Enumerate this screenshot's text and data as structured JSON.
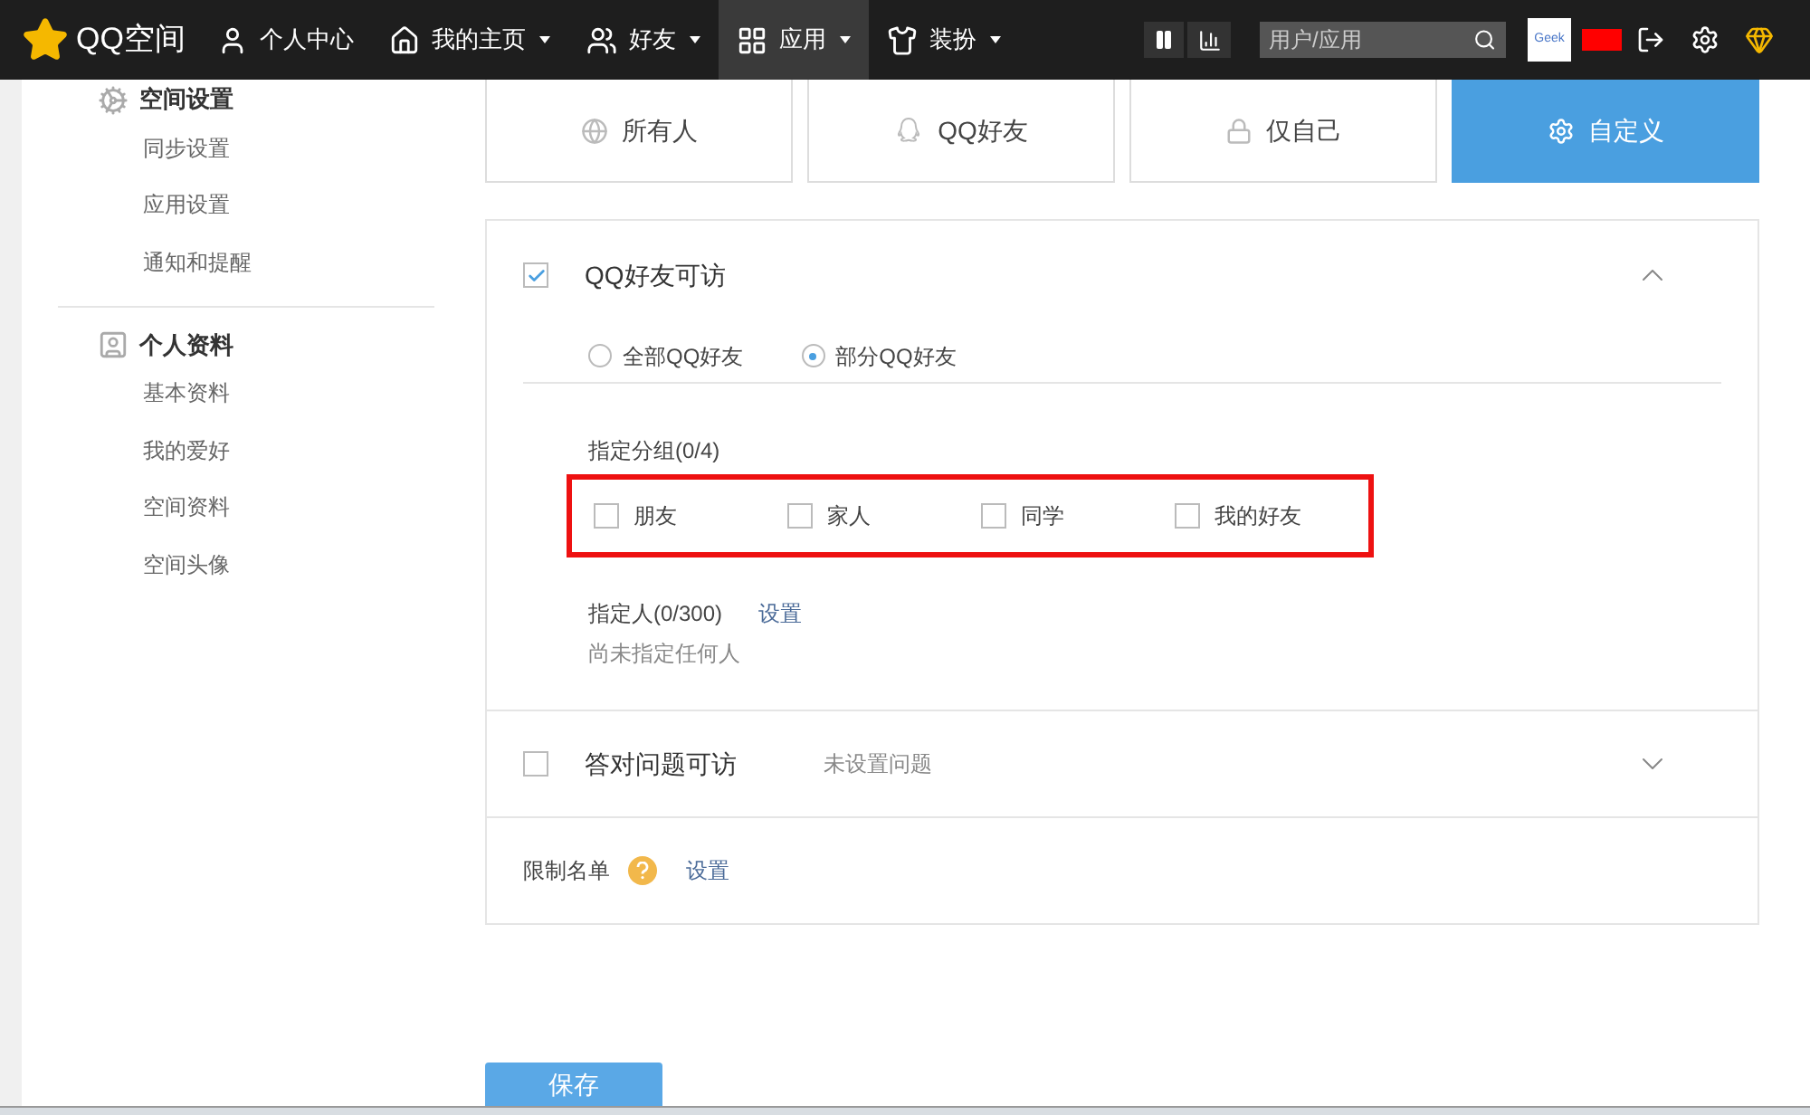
{
  "navbar": {
    "logo": "QQ空间",
    "items": [
      {
        "label": "个人中心",
        "dropdown": false,
        "selected": false
      },
      {
        "label": "我的主页",
        "dropdown": true,
        "selected": false
      },
      {
        "label": "好友",
        "dropdown": true,
        "selected": false
      },
      {
        "label": "应用",
        "dropdown": true,
        "selected": true
      },
      {
        "label": "装扮",
        "dropdown": true,
        "selected": false
      }
    ],
    "search": {
      "placeholder": "用户/应用"
    },
    "avatar_text": "Geek"
  },
  "sidebar": {
    "groups": [
      {
        "title": "空间设置",
        "items": [
          "同步设置",
          "应用设置",
          "通知和提醒"
        ]
      },
      {
        "title": "个人资料",
        "items": [
          "基本资料",
          "我的爱好",
          "空间资料",
          "空间头像"
        ]
      }
    ]
  },
  "visibility_tabs": [
    {
      "label": "所有人",
      "selected": false
    },
    {
      "label": "QQ好友",
      "selected": false
    },
    {
      "label": "仅自己",
      "selected": false
    },
    {
      "label": "自定义",
      "selected": true
    }
  ],
  "friends_section": {
    "title": "QQ好友可访",
    "checked": true,
    "expanded": true,
    "radios": [
      {
        "label": "全部QQ好友",
        "selected": false
      },
      {
        "label": "部分QQ好友",
        "selected": true
      }
    ],
    "groups_label": "指定分组(0/4)",
    "highlighted": true,
    "groups": [
      {
        "label": "朋友",
        "checked": false
      },
      {
        "label": "家人",
        "checked": false
      },
      {
        "label": "同学",
        "checked": false
      },
      {
        "label": "我的好友",
        "checked": false
      }
    ],
    "people_label": "指定人(0/300)",
    "people_link": "设置",
    "people_note": "尚未指定任何人"
  },
  "question_section": {
    "title": "答对问题可访",
    "checked": false,
    "expanded": false,
    "note": "未设置问题"
  },
  "blocklist": {
    "label": "限制名单",
    "link": "设置"
  },
  "save_button": "保存"
}
